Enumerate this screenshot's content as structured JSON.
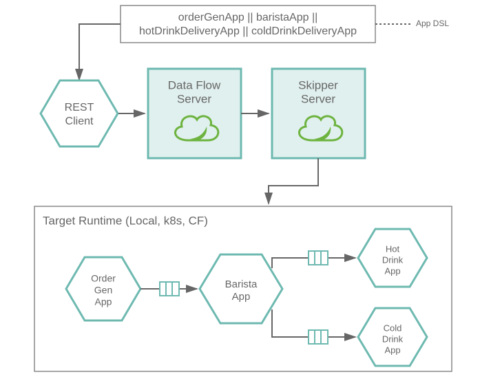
{
  "colors": {
    "teal": "#6db9b0",
    "hexStroke": "#6db9b0",
    "grey": "#666666",
    "spring": "#6db33f"
  },
  "dslBox": {
    "line1": "orderGenApp || baristaApp ||",
    "line2": "hotDrinkDeliveryApp || coldDrinkDeliveryApp"
  },
  "annotation": "App DSL",
  "restClient": "REST\nClient",
  "dataFlow": "Data Flow\nServer",
  "skipper": "Skipper\nServer",
  "runtimeTitle": "Target Runtime (Local, k8s, CF)",
  "orderGen": "Order\nGen\nApp",
  "barista": "Barista\nApp",
  "hotDrink": "Hot\nDrink\nApp",
  "coldDrink": "Cold\nDrink\nApp"
}
